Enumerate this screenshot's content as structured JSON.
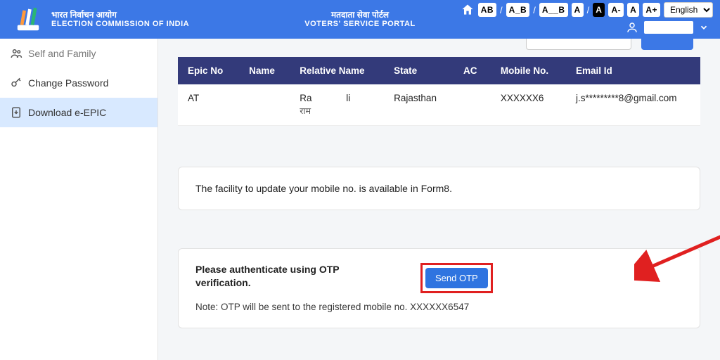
{
  "header": {
    "org_hi": "भारत निर्वाचन आयोग",
    "org_en": "ELECTION COMMISSION OF INDIA",
    "portal_hi": "मतदाता सेवा पोर्टल",
    "portal_en": "VOTERS' SERVICE PORTAL",
    "acc": {
      "ab": "AB",
      "a_b": "A_B",
      "a__b": "A__B",
      "a1": "A",
      "a2": "A",
      "am": "A-",
      "a3": "A",
      "ap": "A+"
    },
    "lang": "English"
  },
  "sidebar": {
    "items": [
      {
        "label": "Self and Family"
      },
      {
        "label": "Change Password"
      },
      {
        "label": "Download e-EPIC"
      }
    ]
  },
  "table": {
    "headers": {
      "epic": "Epic No",
      "name": "Name",
      "rel": "Relative Name",
      "state": "State",
      "ac": "AC",
      "mob": "Mobile No.",
      "email": "Email Id"
    },
    "row": {
      "epic": "AT",
      "name": "",
      "rel1": "Ra             li",
      "rel2": "राम",
      "state": "Rajasthan",
      "ac": "",
      "mob": "XXXXXX6",
      "email": "j.s*********8@gmail.com"
    }
  },
  "notice": "The facility to update your mobile no. is available in Form8.",
  "otp": {
    "title": "Please authenticate using OTP verification.",
    "button": "Send OTP",
    "note": "Note: OTP will be sent to the registered mobile no. XXXXXX6547"
  }
}
